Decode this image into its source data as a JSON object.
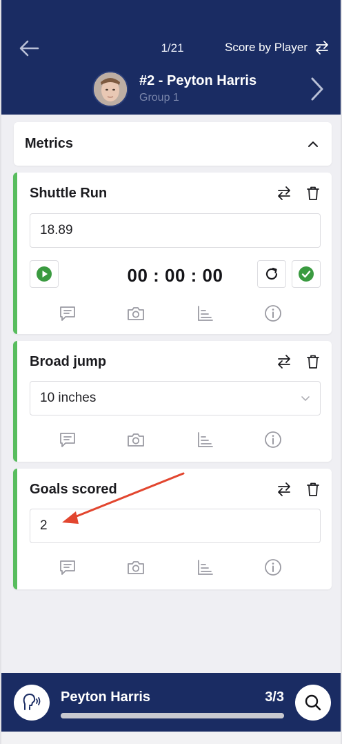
{
  "header": {
    "counter": "1/21",
    "mode_label": "Score by Player",
    "player_name": "#2 - Peyton Harris",
    "player_group": "Group 1"
  },
  "metrics_section": {
    "title": "Metrics"
  },
  "metrics": [
    {
      "title": "Shuttle Run",
      "value": "18.89",
      "timer": "00 : 00 : 00"
    },
    {
      "title": "Broad jump",
      "selected": "10 inches"
    },
    {
      "title": "Goals scored",
      "value": "2"
    }
  ],
  "footer": {
    "player_name": "Peyton Harris",
    "count": "3/3",
    "progress": 1.0
  },
  "colors": {
    "header_bg": "#1a2c63",
    "accent_green": "#58bd5e",
    "check_green": "#3a9a40",
    "annotation_arrow": "#e2462f"
  }
}
